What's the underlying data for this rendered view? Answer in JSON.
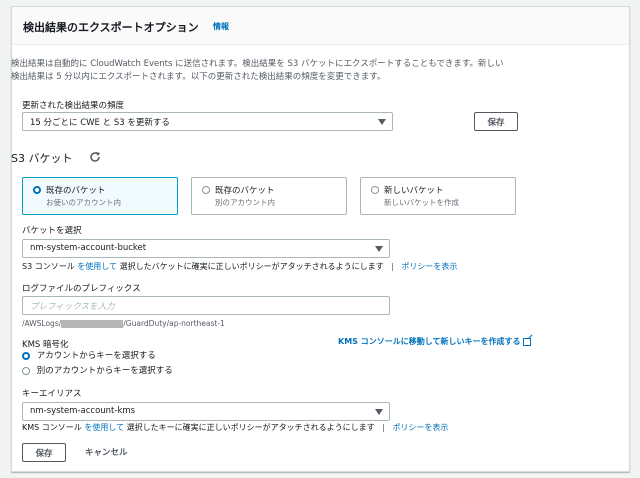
{
  "header": {
    "title": "検出結果のエクスポートオプション",
    "info_link": "情報"
  },
  "description": "検出結果は自動的に CloudWatch Events に送信されます。検出結果を S3 バケットにエクスポートすることもできます。新しい検出結果は 5 分以内にエクスポートされます。以下の更新された検出結果の頻度を変更できます。",
  "frequency": {
    "label": "更新された検出結果の頻度",
    "selected": "15 分ごとに CWE と S3 を更新する",
    "save_label": "保存"
  },
  "s3": {
    "heading": "S3 バケット",
    "tiles": [
      {
        "title": "既存のバケット",
        "subtitle": "お使いのアカウント内",
        "selected": true
      },
      {
        "title": "既存のバケット",
        "subtitle": "別のアカウント内",
        "selected": false
      },
      {
        "title": "新しいバケット",
        "subtitle": "新しいバケットを作成",
        "selected": false
      }
    ],
    "bucket_label": "バケットを選択",
    "bucket_selected": "nm-system-account-bucket",
    "bucket_hint_prefix": "S3 コンソール",
    "bucket_hint_link": "を使用して",
    "bucket_hint_suffix": "選択したバケットに確実に正しいポリシーがアタッチされるようにします",
    "bucket_hint_sep": "|",
    "bucket_policy_link": "ポリシーを表示",
    "prefix_label": "ログファイルのプレフィックス",
    "prefix_placeholder": "プレフィックスを入力",
    "path_prefix": "/AWSLogs/",
    "path_suffix": "/GuardDuty/ap-northeast-1"
  },
  "kms": {
    "label": "KMS 暗号化",
    "create_link": "KMS コンソールに移動して新しいキーを作成する",
    "options": [
      {
        "label": "アカウントからキーを選択する",
        "selected": true
      },
      {
        "label": "別のアカウントからキーを選択する",
        "selected": false
      }
    ],
    "alias_label": "キーエイリアス",
    "alias_selected": "nm-system-account-kms",
    "hint_prefix": "KMS コンソール",
    "hint_link": "を使用して",
    "hint_suffix": "選択したキーに確実に正しいポリシーがアタッチされるようにします",
    "hint_sep": "|",
    "policy_link": "ポリシーを表示"
  },
  "footer": {
    "save_label": "保存",
    "cancel_label": "キャンセル"
  },
  "colors": {
    "accent": "#0073bb",
    "selected_tile_border": "#00a1c9",
    "selected_tile_bg": "#f1faff"
  }
}
